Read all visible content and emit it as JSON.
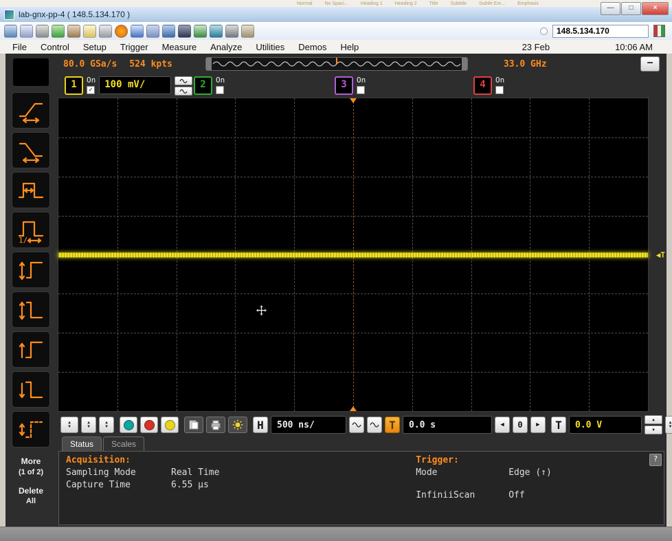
{
  "desktop": {
    "styles": [
      "Normal",
      "No Spaci...",
      "Heading 1",
      "Heading 2",
      "Title",
      "Subtitle",
      "Subtle Em...",
      "Emphasis"
    ]
  },
  "window": {
    "title": "lab-gnx-pp-4 ( 148.5.134.170 )",
    "controls": {
      "min": "—",
      "max": "□",
      "close": "×"
    }
  },
  "toolbar": {
    "ip": "148.5.134.170",
    "icons": [
      "display-icon",
      "layout-icon",
      "cut-icon",
      "refresh-icon",
      "tools-icon",
      "mail-icon",
      "printer-icon",
      "warning-icon",
      "chart-icon",
      "grid-icon",
      "monitor-icon",
      "save-icon",
      "export-icon",
      "flag-icon",
      "camera-icon",
      "image-icon"
    ]
  },
  "menubar": {
    "items": [
      "File",
      "Control",
      "Setup",
      "Trigger",
      "Measure",
      "Analyze",
      "Utilities",
      "Demos",
      "Help"
    ],
    "date": "23 Feb",
    "time": "10:06 AM"
  },
  "scope": {
    "status": {
      "sample_rate": "80.0 GSa/s",
      "memory": "524 kpts",
      "bandwidth": "33.0 GHz",
      "minimize_glyph": "—"
    },
    "channels": [
      {
        "num": "1",
        "on_label": "On",
        "check": "✓",
        "scale": "100 mV/",
        "color": "#e8d21f"
      },
      {
        "num": "2",
        "on_label": "On",
        "check": "",
        "color": "#2fae2f"
      },
      {
        "num": "3",
        "on_label": "On",
        "check": "",
        "color": "#b55cd6"
      },
      {
        "num": "4",
        "on_label": "On",
        "check": "",
        "color": "#e04040"
      }
    ],
    "trigger_marker": "◀T",
    "controls": {
      "up": "▲",
      "down": "▼",
      "h_label": "H",
      "timebase": "500 ns/",
      "time_ref": "T",
      "delay": "0.0 s",
      "left": "◀",
      "zero": "0",
      "right": "▶",
      "trig_label": "T",
      "trig_level": "0.0 V"
    },
    "sidebar": {
      "more": "More",
      "more_sub": "(1 of 2)",
      "delete": "Delete",
      "delete_sub": "All"
    },
    "tabs": [
      {
        "label": "Status"
      },
      {
        "label": "Scales"
      }
    ],
    "info": {
      "acq_title": "Acquisition:",
      "acq_rows": [
        {
          "k": "Sampling Mode",
          "v": "Real Time"
        },
        {
          "k": "Capture Time",
          "v": "6.55 µs"
        }
      ],
      "trig_title": "Trigger:",
      "trig_rows": [
        {
          "k": "Mode",
          "v": "Edge (↑)"
        },
        {
          "k": "InfiniiScan",
          "v": "Off"
        }
      ],
      "help": "?"
    }
  }
}
